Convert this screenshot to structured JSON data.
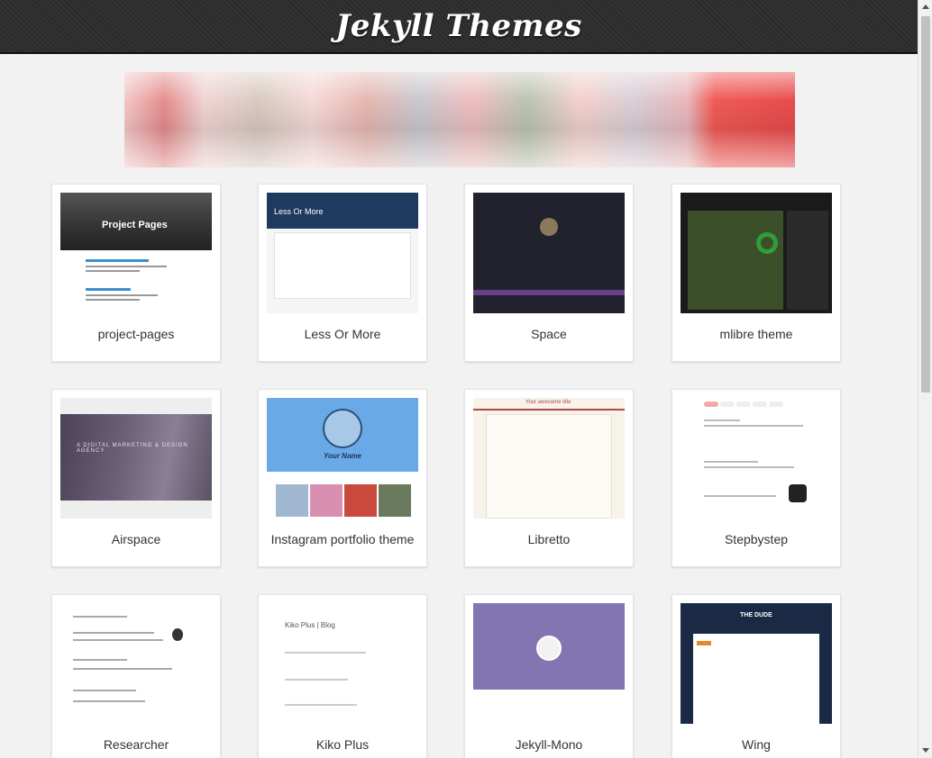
{
  "header": {
    "title": "Jekyll Themes"
  },
  "themes": [
    {
      "name": "project-pages",
      "thumb": "project-pages"
    },
    {
      "name": "Less Or More",
      "thumb": "less-or-more"
    },
    {
      "name": "Space",
      "thumb": "space"
    },
    {
      "name": "mlibre theme",
      "thumb": "mlibre"
    },
    {
      "name": "Airspace",
      "thumb": "airspace"
    },
    {
      "name": "Instagram portfolio theme",
      "thumb": "instagram"
    },
    {
      "name": "Libretto",
      "thumb": "libretto"
    },
    {
      "name": "Stepbystep",
      "thumb": "stepbystep"
    },
    {
      "name": "Researcher",
      "thumb": "researcher"
    },
    {
      "name": "Kiko Plus",
      "thumb": "kiko-plus"
    },
    {
      "name": "Jekyll-Mono",
      "thumb": "jekyll-mono"
    },
    {
      "name": "Wing",
      "thumb": "wing"
    }
  ],
  "thumb_text": {
    "project_pages": "Project Pages",
    "less_or_more": "Less Or More",
    "airspace": "A DIGITAL MARKETING & DESIGN AGENCY",
    "instagram_name": "Your Name",
    "libretto_title": "Your awesome title",
    "kiko": "Kiko Plus | Blog",
    "wing": "THE DUDE"
  },
  "colors": {
    "header_bg": "#2b2b2b",
    "page_bg": "#f2f2f2",
    "card_bg": "#ffffff"
  }
}
